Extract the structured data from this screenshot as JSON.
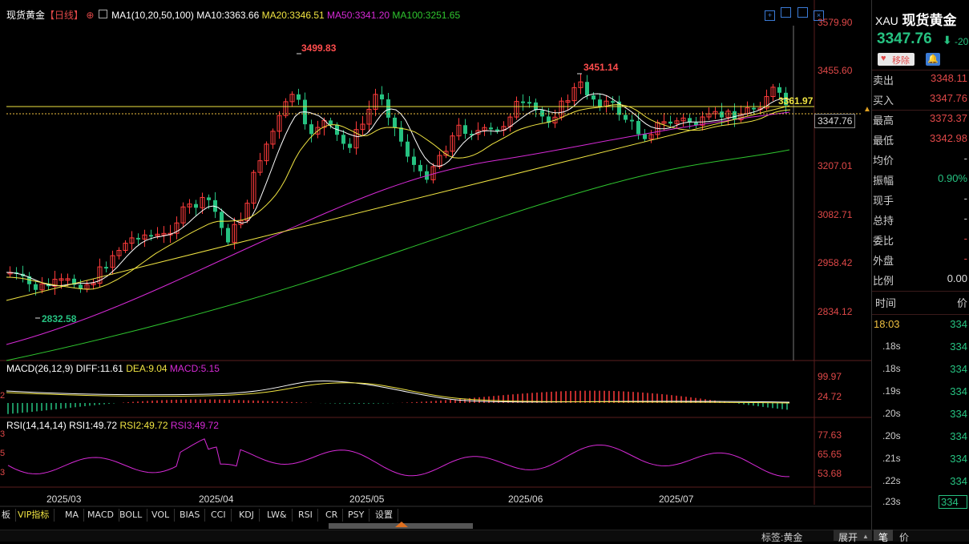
{
  "header": {
    "name": "现货黄金",
    "period": "【日线】",
    "ma_label": "MA1(10,20,50,100)",
    "ma10": "MA10:3363.66",
    "ma20": "MA20:3346.51",
    "ma50": "MA50:3341.20",
    "ma100": "MA100:3251.65"
  },
  "price_axis": [
    "3579.90",
    "3455.60",
    "3207.01",
    "3082.71",
    "2958.42",
    "2834.12"
  ],
  "price_marks": {
    "high1": "3499.83",
    "high2": "3451.14",
    "low1": "2832.58",
    "line_value": "3361.97",
    "current": "3347.76"
  },
  "macd": {
    "label": "MACD(26,12,9)",
    "diff": "DIFF:11.61",
    "dea": "DEA:9.04",
    "macd": "MACD:5.15",
    "axis": [
      "99.97",
      "24.72"
    ],
    "left_stub": "2"
  },
  "rsi": {
    "label": "RSI(14,14,14)",
    "rsi1": "RSI1:49.72",
    "rsi2": "RSI2:49.72",
    "rsi3": "RSI3:49.72",
    "axis": [
      "77.63",
      "65.65",
      "53.68"
    ],
    "left_stubs": [
      "3",
      "5",
      "3"
    ]
  },
  "date_axis": [
    "2025/03",
    "2025/04",
    "2025/05",
    "2025/06",
    "2025/07"
  ],
  "tabs": [
    "板",
    "VIP指标",
    "MA",
    "MACD",
    "BOLL",
    "VOL",
    "BIAS",
    "CCI",
    "KDJ",
    "LW&",
    "RSI",
    "CR",
    "PSY",
    "设置"
  ],
  "status_bar": {
    "tag": "标签:黄金",
    "expand": "展开",
    "pen": "笔",
    "price": "价"
  },
  "right_panel": {
    "symbol": "XAU",
    "name": "现货黄金",
    "price": "3347.76",
    "change": "-20",
    "remove_label": "移除",
    "rows": [
      {
        "label": "卖出",
        "value": "3348.11",
        "color": "#e04848"
      },
      {
        "label": "买入",
        "value": "3347.76",
        "color": "#e04848"
      },
      {
        "label": "最高",
        "value": "3373.37",
        "color": "#e04848"
      },
      {
        "label": "最低",
        "value": "3342.98",
        "color": "#e04848"
      },
      {
        "label": "均价",
        "value": "-",
        "color": "#ccc"
      },
      {
        "label": "振幅",
        "value": "0.90%",
        "color": "#26c281"
      },
      {
        "label": "现手",
        "value": "-",
        "color": "#ccc"
      },
      {
        "label": "总持",
        "value": "-",
        "color": "#ccc"
      },
      {
        "label": "委比",
        "value": "-",
        "color": "#e04848"
      },
      {
        "label": "外盘",
        "value": "-",
        "color": "#e04848"
      },
      {
        "label": "比例",
        "value": "0.00",
        "color": "#ddd"
      }
    ],
    "ticks_header": {
      "time": "时间",
      "price": "价"
    },
    "ticks": [
      {
        "time": "18:03",
        "price": "334"
      },
      {
        "time": ".18s",
        "price": "334"
      },
      {
        "time": ".18s",
        "price": "334"
      },
      {
        "time": ".19s",
        "price": "334"
      },
      {
        "time": ".20s",
        "price": "334"
      },
      {
        "time": ".20s",
        "price": "334"
      },
      {
        "time": ".21s",
        "price": "334"
      },
      {
        "time": ".22s",
        "price": "334"
      },
      {
        "time": ".23s",
        "price": "334"
      }
    ]
  },
  "colors": {
    "up": "#ff3b3b",
    "down": "#26c281",
    "ma10": "#ffffff",
    "ma20": "#f0e442",
    "ma50": "#d62ad6",
    "ma100": "#2fc62f"
  }
}
